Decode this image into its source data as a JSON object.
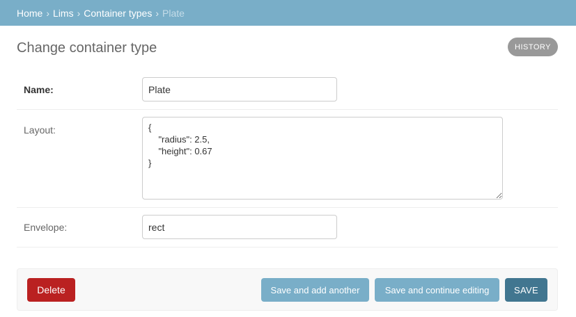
{
  "breadcrumbs": {
    "items": [
      "Home",
      "Lims",
      "Container types"
    ],
    "separator": "›",
    "current": "Plate"
  },
  "page": {
    "title": "Change container type",
    "history_label": "HISTORY"
  },
  "form": {
    "name": {
      "label": "Name:",
      "value": "Plate"
    },
    "layout": {
      "label": "Layout:",
      "value": "{\n    \"radius\": 2.5,\n    \"height\": 0.67\n}"
    },
    "envelope": {
      "label": "Envelope:",
      "value": "rect"
    }
  },
  "actions": {
    "delete_label": "Delete",
    "save_add_another_label": "Save and add another",
    "save_continue_label": "Save and continue editing",
    "save_label": "SAVE"
  },
  "colors": {
    "header_bg": "#79aec8",
    "primary_button": "#417690",
    "secondary_button": "#79aec8",
    "delete_button": "#ba2121",
    "history_button": "#999999"
  }
}
